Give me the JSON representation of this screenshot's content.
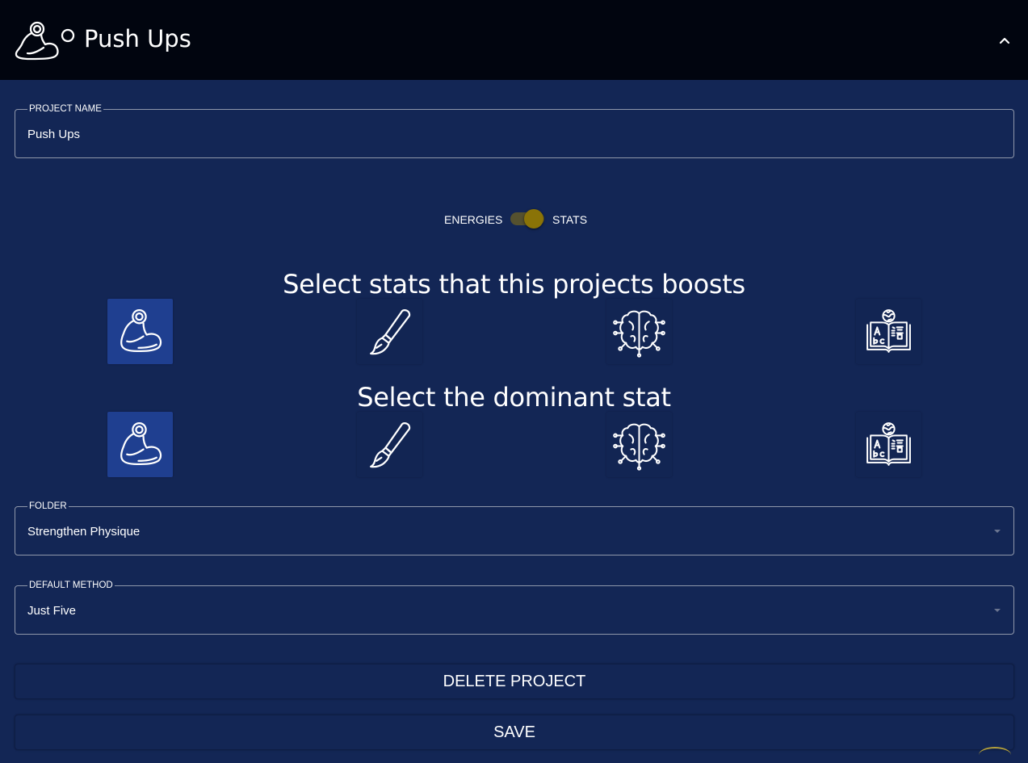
{
  "header": {
    "title": "Push Ups",
    "logo_icon": "flexed-bicep-icon",
    "collapse_icon": "chevron-up-icon"
  },
  "project_name": {
    "label": "PROJECT NAME",
    "value": "Push Ups"
  },
  "toggle": {
    "left_label": "ENERGIES",
    "right_label": "STATS",
    "state": "STATS"
  },
  "boost_section": {
    "title": "Select stats that this projects boosts",
    "stats": [
      {
        "icon": "flexed-bicep-icon",
        "selected": true
      },
      {
        "icon": "paintbrush-icon",
        "selected": false
      },
      {
        "icon": "brain-circuit-icon",
        "selected": false
      },
      {
        "icon": "language-book-icon",
        "selected": false
      }
    ]
  },
  "dominant_section": {
    "title": "Select the dominant stat",
    "stats": [
      {
        "icon": "flexed-bicep-icon",
        "selected": true
      },
      {
        "icon": "paintbrush-icon",
        "selected": false
      },
      {
        "icon": "brain-circuit-icon",
        "selected": false
      },
      {
        "icon": "language-book-icon",
        "selected": false
      }
    ]
  },
  "folder": {
    "label": "FOLDER",
    "value": "Strengthen Physique"
  },
  "default_method": {
    "label": "DEFAULT METHOD",
    "value": "Just Five"
  },
  "actions": {
    "delete_label": "DELETE PROJECT",
    "save_label": "SAVE"
  },
  "colors": {
    "background": "#132655",
    "header": "#01050f",
    "selected_tile": "#1f3f90",
    "toggle_thumb": "#8a7307"
  }
}
